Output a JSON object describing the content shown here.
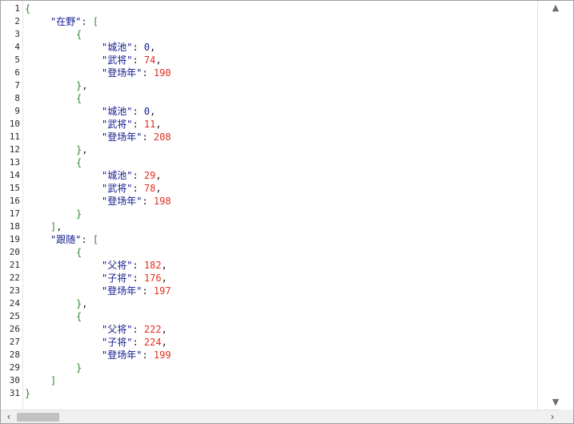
{
  "editor": {
    "line_numbers": [
      "1",
      "2",
      "3",
      "4",
      "5",
      "6",
      "7",
      "8",
      "9",
      "10",
      "11",
      "12",
      "13",
      "14",
      "15",
      "16",
      "17",
      "18",
      "19",
      "20",
      "21",
      "22",
      "23",
      "24",
      "25",
      "26",
      "27",
      "28",
      "29",
      "30",
      "31"
    ],
    "lines": [
      {
        "indent": 0,
        "tokens": [
          {
            "t": "{",
            "c": "br"
          }
        ]
      },
      {
        "indent": 1,
        "tokens": [
          {
            "t": "\"在野\"",
            "c": "key"
          },
          {
            "t": ": ",
            "c": "punc"
          },
          {
            "t": "[",
            "c": "br"
          }
        ]
      },
      {
        "indent": 2,
        "tokens": [
          {
            "t": "{",
            "c": "br"
          }
        ]
      },
      {
        "indent": 3,
        "tokens": [
          {
            "t": "\"城池\"",
            "c": "key"
          },
          {
            "t": ": ",
            "c": "punc"
          },
          {
            "t": "0",
            "c": "key"
          },
          {
            "t": ",",
            "c": "punc"
          }
        ]
      },
      {
        "indent": 3,
        "tokens": [
          {
            "t": "\"武将\"",
            "c": "key"
          },
          {
            "t": ": ",
            "c": "punc"
          },
          {
            "t": "74",
            "c": "num"
          },
          {
            "t": ",",
            "c": "punc"
          }
        ]
      },
      {
        "indent": 3,
        "tokens": [
          {
            "t": "\"登场年\"",
            "c": "key"
          },
          {
            "t": ": ",
            "c": "punc"
          },
          {
            "t": "190",
            "c": "num"
          }
        ]
      },
      {
        "indent": 2,
        "tokens": [
          {
            "t": "}",
            "c": "br"
          },
          {
            "t": ",",
            "c": "punc"
          }
        ]
      },
      {
        "indent": 2,
        "tokens": [
          {
            "t": "{",
            "c": "br"
          }
        ]
      },
      {
        "indent": 3,
        "tokens": [
          {
            "t": "\"城池\"",
            "c": "key"
          },
          {
            "t": ": ",
            "c": "punc"
          },
          {
            "t": "0",
            "c": "key"
          },
          {
            "t": ",",
            "c": "punc"
          }
        ]
      },
      {
        "indent": 3,
        "tokens": [
          {
            "t": "\"武将\"",
            "c": "key"
          },
          {
            "t": ": ",
            "c": "punc"
          },
          {
            "t": "11",
            "c": "num"
          },
          {
            "t": ",",
            "c": "punc"
          }
        ]
      },
      {
        "indent": 3,
        "tokens": [
          {
            "t": "\"登场年\"",
            "c": "key"
          },
          {
            "t": ": ",
            "c": "punc"
          },
          {
            "t": "208",
            "c": "num"
          }
        ]
      },
      {
        "indent": 2,
        "tokens": [
          {
            "t": "}",
            "c": "br"
          },
          {
            "t": ",",
            "c": "punc"
          }
        ]
      },
      {
        "indent": 2,
        "tokens": [
          {
            "t": "{",
            "c": "br"
          }
        ]
      },
      {
        "indent": 3,
        "tokens": [
          {
            "t": "\"城池\"",
            "c": "key"
          },
          {
            "t": ": ",
            "c": "punc"
          },
          {
            "t": "29",
            "c": "num"
          },
          {
            "t": ",",
            "c": "punc"
          }
        ]
      },
      {
        "indent": 3,
        "tokens": [
          {
            "t": "\"武将\"",
            "c": "key"
          },
          {
            "t": ": ",
            "c": "punc"
          },
          {
            "t": "78",
            "c": "num"
          },
          {
            "t": ",",
            "c": "punc"
          }
        ]
      },
      {
        "indent": 3,
        "tokens": [
          {
            "t": "\"登场年\"",
            "c": "key"
          },
          {
            "t": ": ",
            "c": "punc"
          },
          {
            "t": "198",
            "c": "num"
          }
        ]
      },
      {
        "indent": 2,
        "tokens": [
          {
            "t": "}",
            "c": "br"
          }
        ]
      },
      {
        "indent": 1,
        "tokens": [
          {
            "t": "]",
            "c": "br"
          },
          {
            "t": ",",
            "c": "punc"
          }
        ]
      },
      {
        "indent": 1,
        "tokens": [
          {
            "t": "\"跟随\"",
            "c": "key"
          },
          {
            "t": ": ",
            "c": "punc"
          },
          {
            "t": "[",
            "c": "br"
          }
        ]
      },
      {
        "indent": 2,
        "tokens": [
          {
            "t": "{",
            "c": "br"
          }
        ]
      },
      {
        "indent": 3,
        "tokens": [
          {
            "t": "\"父将\"",
            "c": "key"
          },
          {
            "t": ": ",
            "c": "punc"
          },
          {
            "t": "182",
            "c": "num"
          },
          {
            "t": ",",
            "c": "punc"
          }
        ]
      },
      {
        "indent": 3,
        "tokens": [
          {
            "t": "\"子将\"",
            "c": "key"
          },
          {
            "t": ": ",
            "c": "punc"
          },
          {
            "t": "176",
            "c": "num"
          },
          {
            "t": ",",
            "c": "punc"
          }
        ]
      },
      {
        "indent": 3,
        "tokens": [
          {
            "t": "\"登场年\"",
            "c": "key"
          },
          {
            "t": ": ",
            "c": "punc"
          },
          {
            "t": "197",
            "c": "num"
          }
        ]
      },
      {
        "indent": 2,
        "tokens": [
          {
            "t": "}",
            "c": "br"
          },
          {
            "t": ",",
            "c": "punc"
          }
        ]
      },
      {
        "indent": 2,
        "tokens": [
          {
            "t": "{",
            "c": "br"
          }
        ]
      },
      {
        "indent": 3,
        "tokens": [
          {
            "t": "\"父将\"",
            "c": "key"
          },
          {
            "t": ": ",
            "c": "punc"
          },
          {
            "t": "222",
            "c": "num"
          },
          {
            "t": ",",
            "c": "punc"
          }
        ]
      },
      {
        "indent": 3,
        "tokens": [
          {
            "t": "\"子将\"",
            "c": "key"
          },
          {
            "t": ": ",
            "c": "punc"
          },
          {
            "t": "224",
            "c": "num"
          },
          {
            "t": ",",
            "c": "punc"
          }
        ]
      },
      {
        "indent": 3,
        "tokens": [
          {
            "t": "\"登场年\"",
            "c": "key"
          },
          {
            "t": ": ",
            "c": "punc"
          },
          {
            "t": "199",
            "c": "num"
          }
        ]
      },
      {
        "indent": 2,
        "tokens": [
          {
            "t": "}",
            "c": "br"
          }
        ]
      },
      {
        "indent": 1,
        "tokens": [
          {
            "t": "]",
            "c": "br"
          }
        ]
      },
      {
        "indent": 0,
        "tokens": [
          {
            "t": "}",
            "c": "br"
          }
        ]
      }
    ]
  },
  "colors": {
    "bracket": "#2e8b2e",
    "key": "#0f1a8c",
    "number": "#e03020",
    "scrollbar_thumb": "#c2c2c2"
  },
  "scrollbars": {
    "up_arrow_icon": "▲",
    "down_arrow_icon": "▼",
    "left_arrow_icon": "‹",
    "right_arrow_icon": "›"
  }
}
